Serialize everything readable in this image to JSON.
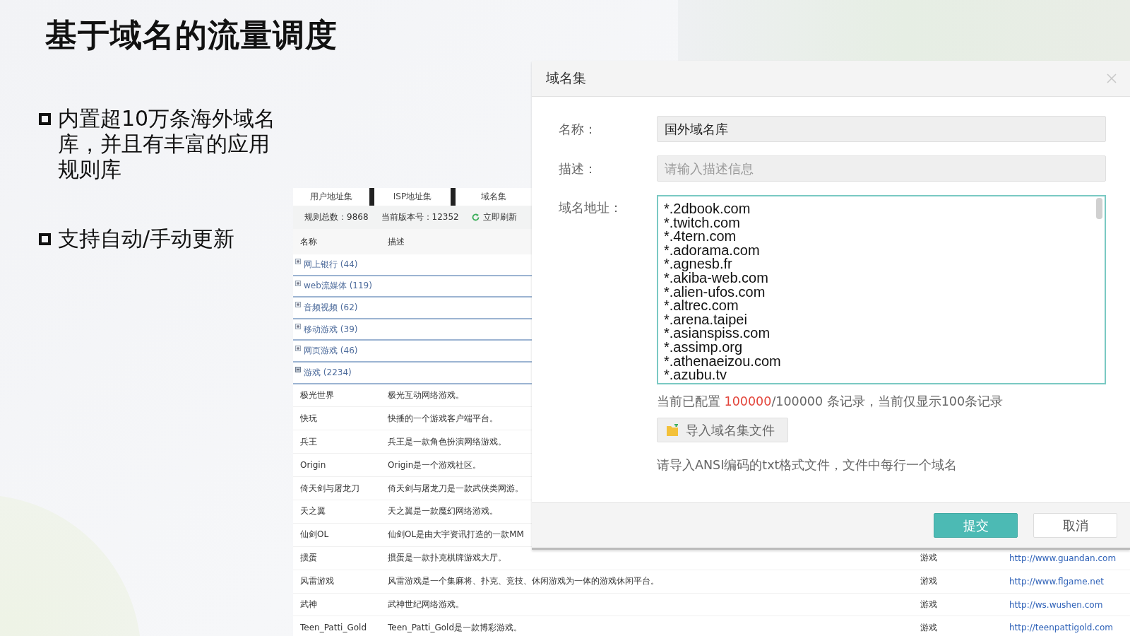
{
  "slide": {
    "title": "基于域名的流量调度",
    "bullets": [
      "内置超10万条海外域名库，并且有丰富的应用规则库",
      "支持自动/手动更新"
    ]
  },
  "rule_table": {
    "tabs": [
      {
        "label": "用户地址集"
      },
      {
        "label": "ISP地址集"
      },
      {
        "label": "域名集"
      }
    ],
    "summary": {
      "total_label": "规则总数：9868",
      "version_label": "当前版本号：12352",
      "refresh": "立即刷新"
    },
    "columns": [
      "名称",
      "描述"
    ],
    "groups": [
      {
        "label": "网上银行 (44)",
        "expanded": false
      },
      {
        "label": "web流媒体 (119)",
        "expanded": false
      },
      {
        "label": "音频视频 (62)",
        "expanded": false
      },
      {
        "label": "移动游戏 (39)",
        "expanded": false
      },
      {
        "label": "网页游戏 (46)",
        "expanded": false
      },
      {
        "label": "游戏 (2234)",
        "expanded": true,
        "children": [
          {
            "name": "极光世界",
            "description": "极光互动网络游戏。"
          },
          {
            "name": "快玩",
            "description": "快播的一个游戏客户端平台。"
          },
          {
            "name": "兵王",
            "description": "兵王是一款角色扮演网络游戏。"
          },
          {
            "name": "Origin",
            "description": "Origin是一个游戏社区。"
          },
          {
            "name": "倚天剑与屠龙刀",
            "description": "倚天剑与屠龙刀是一款武侠类网游。"
          },
          {
            "name": "天之翼",
            "description": "天之翼是一款魔幻网络游戏。"
          },
          {
            "name": "仙剑OL",
            "description": "仙剑OL是由大宇资讯打造的一款MM"
          },
          {
            "name": "掼蛋",
            "description": "掼蛋是一款扑克棋牌游戏大厅。",
            "column_3": "游戏",
            "url": "http://www.guandan.com"
          },
          {
            "name": "风雷游戏",
            "description": "风雷游戏是一个集麻将、扑克、竞技、休闲游戏为一体的游戏休闲平台。",
            "column_3": "游戏",
            "url": "http://www.flgame.net"
          },
          {
            "name": "武神",
            "description": "武神世纪网络游戏。",
            "column_3": "游戏",
            "url": "http://ws.wushen.com"
          },
          {
            "name": "Teen_Patti_Gold",
            "description": "Teen_Patti_Gold是一款博彩游戏。",
            "column_3": "游戏",
            "url": "http://teenpattigold.com"
          }
        ]
      }
    ]
  },
  "dialog": {
    "title": "域名集",
    "fields": [
      {
        "label": "名称：",
        "value": "国外域名库"
      },
      {
        "label": "描述：",
        "placeholder": "请输入描述信息"
      }
    ],
    "domains": {
      "label": "域名地址：",
      "lines": [
        "*.2dbook.com",
        "*.twitch.com",
        "*.4tern.com",
        "*.adorama.com",
        "*.agnesb.fr",
        "*.akiba-web.com",
        "*.alien-ufos.com",
        "*.altrec.com",
        "*.arena.taipei",
        "*.asianspiss.com",
        "*.assimp.org",
        "*.athenaeizou.com",
        "*.azubu.tv"
      ]
    },
    "record_note": {
      "prefix": "当前已配置 ",
      "configured": "100000",
      "suffix": "/100000 条记录，当前仅显示100条记录"
    },
    "import_button": "导入域名集文件",
    "hint": "请导入ANSI编码的txt格式文件，文件中每行一个域名",
    "buttons": [
      {
        "label": "提交",
        "kind": "primary"
      },
      {
        "label": "取消",
        "kind": "secondary"
      }
    ]
  }
}
